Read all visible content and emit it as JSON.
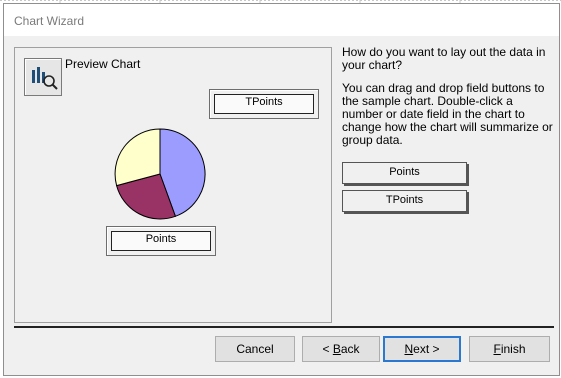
{
  "window": {
    "title": "Chart Wizard"
  },
  "preview": {
    "label": "Preview Chart",
    "icon": "chart-zoom-icon",
    "series_field": "TPoints",
    "category_field": "Points",
    "pie_colors": [
      "#9c9cff",
      "#993366",
      "#ffffcc"
    ]
  },
  "instructions": {
    "question": "How do you want to lay out the data in your chart?",
    "help": "You can drag and drop field buttons to the sample chart. Double-click a number or date field in the chart to change how the chart will summarize or group data."
  },
  "fields": [
    {
      "label": "Points"
    },
    {
      "label": "TPoints"
    }
  ],
  "buttons": {
    "cancel": "Cancel",
    "back_mnemonic": "B",
    "back_rest": "ack",
    "back_prefix": "< ",
    "next_mnemonic": "N",
    "next_rest": "ext >",
    "finish_mnemonic": "F",
    "finish_rest": "inish"
  }
}
